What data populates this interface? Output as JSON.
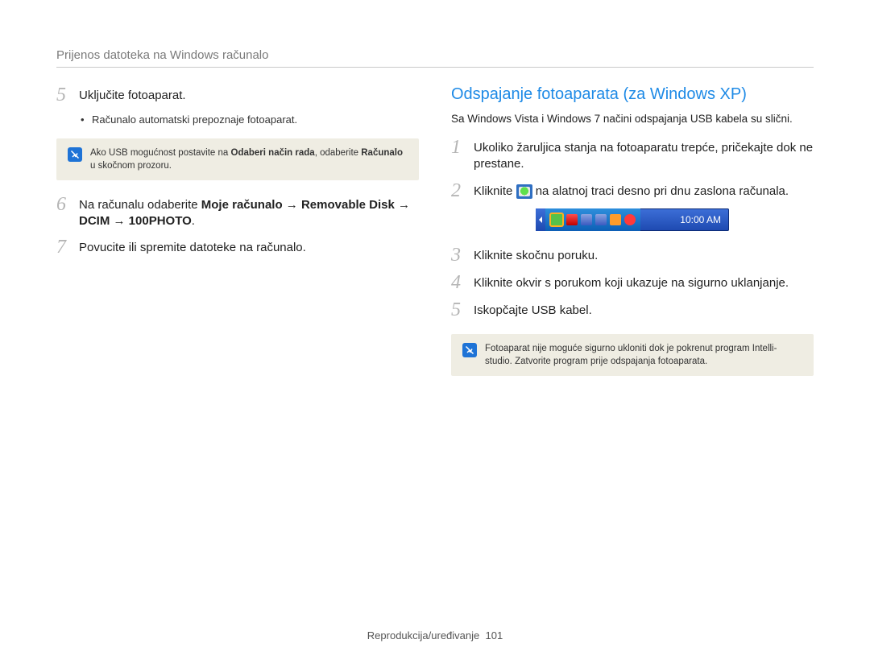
{
  "header": "Prijenos datoteka na Windows računalo",
  "left": {
    "step5": {
      "num": "5",
      "text": "Uključite fotoaparat."
    },
    "step5_sub": "Računalo automatski prepoznaje fotoaparat.",
    "note1_pre": "Ako USB mogućnost postavite na ",
    "note1_b1": "Odaberi način rada",
    "note1_mid": ", odaberite ",
    "note1_b2": "Računalo",
    "note1_post": " u skočnom prozoru.",
    "step6": {
      "num": "6",
      "pre": "Na računalu odaberite ",
      "b1": "Moje računalo",
      "arr1": " → ",
      "b2": "Removable Disk",
      "arr2": " → ",
      "b3": "DCIM",
      "arr3": " → ",
      "b4": "100PHOTO",
      "post": "."
    },
    "step7": {
      "num": "7",
      "text": "Povucite ili spremite datoteke na računalo."
    }
  },
  "right": {
    "title": "Odspajanje fotoaparata (za Windows XP)",
    "intro": "Sa Windows Vista i Windows 7 načini odspajanja USB kabela su slični.",
    "step1": {
      "num": "1",
      "text": "Ukoliko žaruljica stanja na fotoaparatu trepće, pričekajte dok ne prestane."
    },
    "step2": {
      "num": "2",
      "pre": "Kliknite ",
      "post": " na alatnoj traci desno pri dnu zaslona računala."
    },
    "tray_time": "10:00 AM",
    "step3": {
      "num": "3",
      "text": "Kliknite skočnu poruku."
    },
    "step4": {
      "num": "4",
      "text": "Kliknite okvir s porukom koji ukazuje na sigurno uklanjanje."
    },
    "step5": {
      "num": "5",
      "text": "Iskopčajte USB kabel."
    },
    "note2": "Fotoaparat nije moguće sigurno ukloniti dok je pokrenut program Intelli-studio. Zatvorite program prije odspajanja fotoaparata."
  },
  "footer": {
    "label": "Reprodukcija/uređivanje",
    "page": "101"
  }
}
